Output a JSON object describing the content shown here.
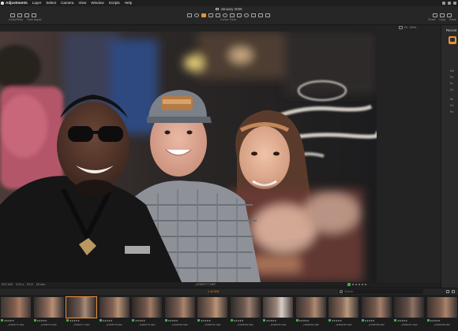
{
  "menubar": {
    "items": [
      "Adjustments",
      "Layer",
      "Select",
      "Camera",
      "View",
      "Window",
      "Scripts",
      "Help"
    ]
  },
  "toolbar": {
    "document_title": "January 2025",
    "cursor_tools_label": "Cursor Tools",
    "left_tools": [
      "",
      "Undo/Redo",
      "Auto adjust"
    ],
    "right_tools": [
      "Reset",
      "Copy",
      "Paste"
    ]
  },
  "viewer": {
    "controls": [
      "Fit",
      "100%"
    ]
  },
  "tools_panel": {
    "title": "Recent",
    "rows": [
      "Ma",
      "Ro",
      "Ex",
      "Ce",
      "Se",
      "Ce",
      "Ro"
    ]
  },
  "info_bar": {
    "iso": "ISO 400",
    "shutter": "1/13 s",
    "aperture": "f/2.8",
    "focal_length": "28 mm",
    "file_name": "_DSR8777.NEF"
  },
  "browser": {
    "count_label": "1 of 116",
    "search_placeholder": "Search"
  },
  "filmstrip": {
    "thumbnails": [
      {
        "name": "_DSR8775.NEF",
        "rating": "★★★★★",
        "colors": [
          "#3b3634",
          "#7e5b4b",
          "#a87a62"
        ]
      },
      {
        "name": "_DSR8776.NEF",
        "rating": "★★★★★",
        "colors": [
          "#342f2e",
          "#8b6a58",
          "#b88f74"
        ]
      },
      {
        "name": "_DSR8777.NEF",
        "rating": "★★★★★",
        "colors": [
          "#2f2a2a",
          "#6f5a52",
          "#a98a77"
        ]
      },
      {
        "name": "_DSR8778.NEF",
        "rating": "★★★★★",
        "colors": [
          "#3a3230",
          "#836352",
          "#b59176"
        ]
      },
      {
        "name": "_DSR8779.NEF",
        "rating": "★★★★★",
        "colors": [
          "#2d2827",
          "#705549",
          "#9f7b65"
        ]
      },
      {
        "name": "_DSR8780.NEF",
        "rating": "★★★★★",
        "colors": [
          "#332d2c",
          "#7a5e50",
          "#a9856d"
        ]
      },
      {
        "name": "_DSR8781.NEF",
        "rating": "★★★★★",
        "colors": [
          "#3c3432",
          "#8a6a58",
          "#bc9478"
        ]
      },
      {
        "name": "_DSR8782.NEF",
        "rating": "★★★★★",
        "colors": [
          "#2e2a29",
          "#6d5a50",
          "#9e8070"
        ]
      },
      {
        "name": "_DSR8783.NEF",
        "rating": "★★★★★",
        "colors": [
          "#423a37",
          "#9a8578",
          "#d8cfc7"
        ]
      },
      {
        "name": "_DSR8784.NEF",
        "rating": "★★★★★",
        "colors": [
          "#383130",
          "#7d6150",
          "#ae8a72"
        ]
      },
      {
        "name": "_DSR8785.NEF",
        "rating": "★★★★★",
        "colors": [
          "#3a3331",
          "#876a58",
          "#b99a80"
        ]
      },
      {
        "name": "_DSR8786.NEF",
        "rating": "★★★★★",
        "colors": [
          "#302b2a",
          "#73594c",
          "#a3806b"
        ]
      },
      {
        "name": "_DSR8787.NEF",
        "rating": "★★★★★",
        "colors": [
          "#2c2827",
          "#5f4d45",
          "#8d7266"
        ]
      },
      {
        "name": "_DSR8788.NEF",
        "rating": "★★★★★",
        "colors": [
          "#3a3230",
          "#7e5f4f",
          "#a9846c"
        ]
      }
    ]
  },
  "colors": {
    "accent": "#e8913a",
    "color_tag_green": "#3fae4d"
  }
}
